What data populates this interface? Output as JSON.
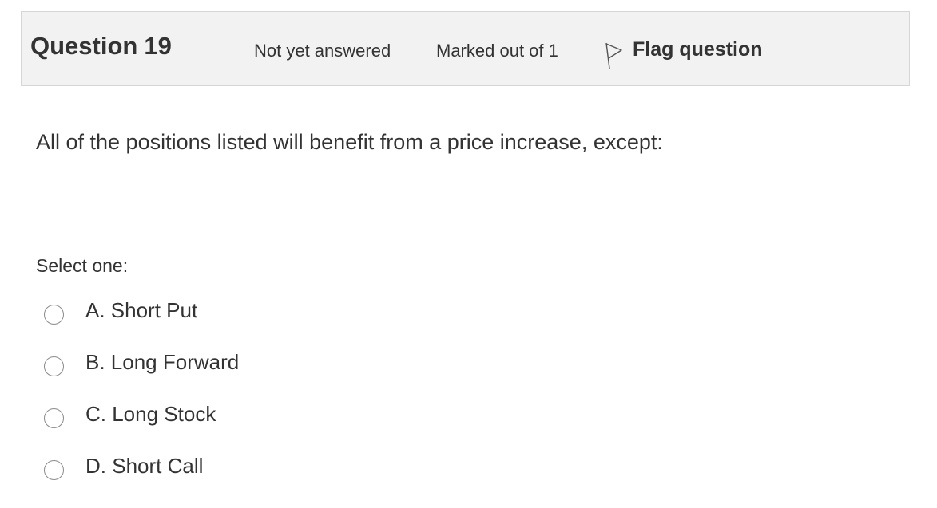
{
  "question": {
    "title_prefix": "Question",
    "number": "19",
    "state": "Not yet answered",
    "grade": "Marked out of 1",
    "flag_label": "Flag question",
    "flag_icon": "flag-outline-icon",
    "text": "All of the positions listed will benefit from a price increase, except:",
    "prompt": "Select one:",
    "options": [
      {
        "label": "A. Short Put"
      },
      {
        "label": "B. Long Forward"
      },
      {
        "label": "C. Long Stock"
      },
      {
        "label": "D. Short Call"
      }
    ]
  }
}
